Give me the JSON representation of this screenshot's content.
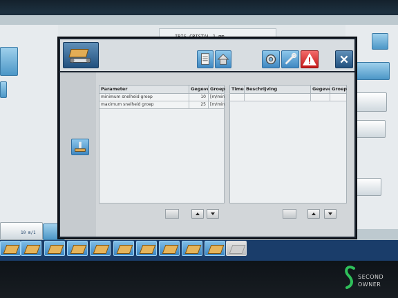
{
  "background": {
    "title": "IRIS CRISTAL  1 mm",
    "speed_badge": "10 m/1"
  },
  "dialog": {
    "left_table": {
      "columns": [
        "Parameter",
        "Gegeven",
        "Groep"
      ],
      "rows": [
        {
          "parameter": "minimum snelheid groep",
          "value": "10",
          "unit": "[m/min]"
        },
        {
          "parameter": "maximum snelheid groep",
          "value": "25",
          "unit": "[m/min]"
        }
      ]
    },
    "right_table": {
      "columns": [
        "Timer",
        "Beschrijving",
        "Gegeven",
        "Groep"
      ]
    }
  },
  "watermark": {
    "line1": "SECOND",
    "line2": "OWNER"
  },
  "colors": {
    "accent": "#3f88c2",
    "alarm": "#c41818",
    "toolbar": "#1a3d6a"
  },
  "icons": {
    "conveyor": "conveyor-icon",
    "document": "document-icon",
    "home": "home-icon",
    "settings": "settings-gear-icon",
    "tools": "tools-icon",
    "warning": "warning-icon",
    "close": "close-icon"
  }
}
